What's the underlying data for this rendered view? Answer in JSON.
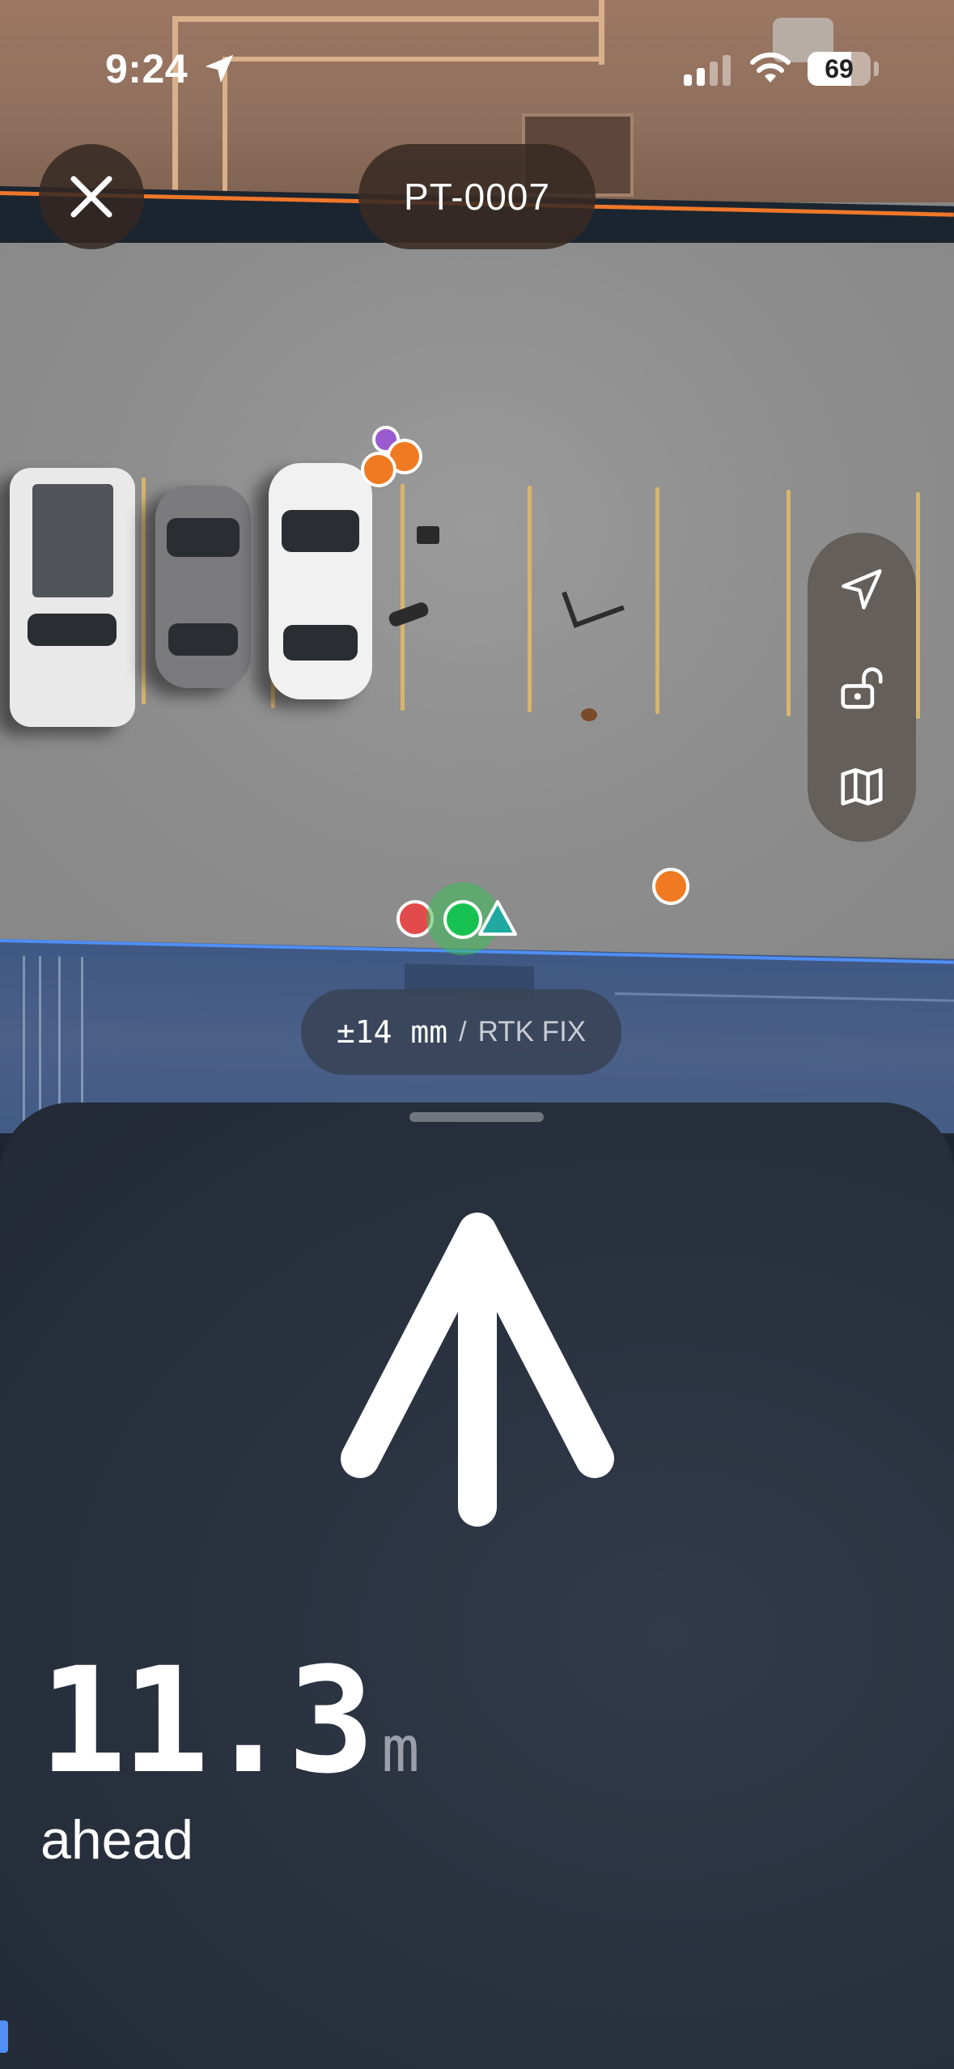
{
  "status_bar": {
    "time": "9:24",
    "battery_level": "69",
    "battery_fraction": 0.69,
    "signal_bars_active": 2,
    "signal_bars_total": 4
  },
  "header": {
    "close_icon": "close-icon",
    "point_id": "PT-0007"
  },
  "side_controls": [
    {
      "name": "recenter",
      "icon": "navigation-arrow-icon"
    },
    {
      "name": "lock",
      "icon": "unlock-icon"
    },
    {
      "name": "map-layers",
      "icon": "map-icon"
    }
  ],
  "map": {
    "markers": [
      {
        "name": "point-marker-purple",
        "color": "#9b5bd0"
      },
      {
        "name": "point-marker-orange",
        "color": "#f07a22"
      },
      {
        "name": "point-marker-orange",
        "color": "#f07a22"
      },
      {
        "name": "point-marker-orange",
        "color": "#f07a22"
      },
      {
        "name": "point-marker-red",
        "color": "#e24b4b"
      },
      {
        "name": "current-position-marker",
        "color": "#18c252"
      },
      {
        "name": "target-marker",
        "color": "#1fa9a0"
      }
    ],
    "boundary_colors": {
      "top": "#f0772a",
      "bottom": "#4f8ef5"
    }
  },
  "accuracy": {
    "value": "±14 mm",
    "separator": "/",
    "mode": "RTK FIX"
  },
  "guidance": {
    "direction_icon": "arrow-up-icon",
    "distance_value": "11.3",
    "distance_unit": "m",
    "direction_text": "ahead"
  }
}
